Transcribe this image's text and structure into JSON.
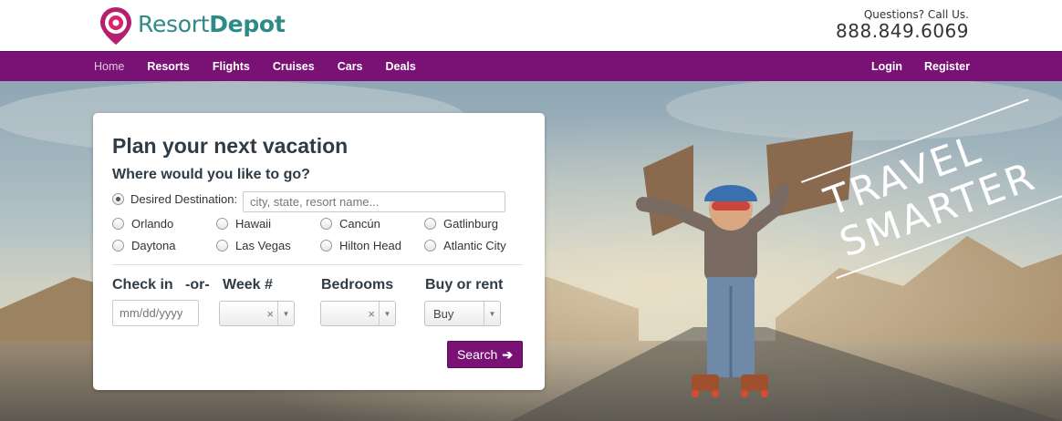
{
  "header": {
    "logo_regular": "Resort",
    "logo_bold": "Depot",
    "contact_question": "Questions?  Call Us.",
    "phone": "888.849.6069"
  },
  "nav": {
    "left": [
      "Home",
      "Resorts",
      "Flights",
      "Cruises",
      "Cars",
      "Deals"
    ],
    "right": [
      "Login",
      "Register"
    ],
    "active": "Home"
  },
  "search": {
    "title": "Plan your next vacation",
    "subtitle": "Where would you like to go?",
    "desired_label": "Desired Destination:",
    "desired_placeholder": "city, state, resort name...",
    "destinations": [
      "Orlando",
      "Hawaii",
      "Cancún",
      "Gatlinburg",
      "Daytona",
      "Las Vegas",
      "Hilton Head",
      "Atlantic City"
    ],
    "checkin_label": "Check in",
    "or_label": "-or-",
    "week_label": "Week #",
    "bedrooms_label": "Bedrooms",
    "buy_rent_label": "Buy or rent",
    "date_placeholder": "mm/dd/yyyy",
    "week_value": "",
    "bedrooms_value": "",
    "buy_rent_value": "Buy",
    "search_button": "Search"
  },
  "hero": {
    "slogan_line1": "TRAVEL",
    "slogan_line2": "SMARTER"
  },
  "colors": {
    "brand_purple": "#7a1276",
    "logo_teal": "#2e8a84",
    "logo_pink": "#c2185b"
  }
}
